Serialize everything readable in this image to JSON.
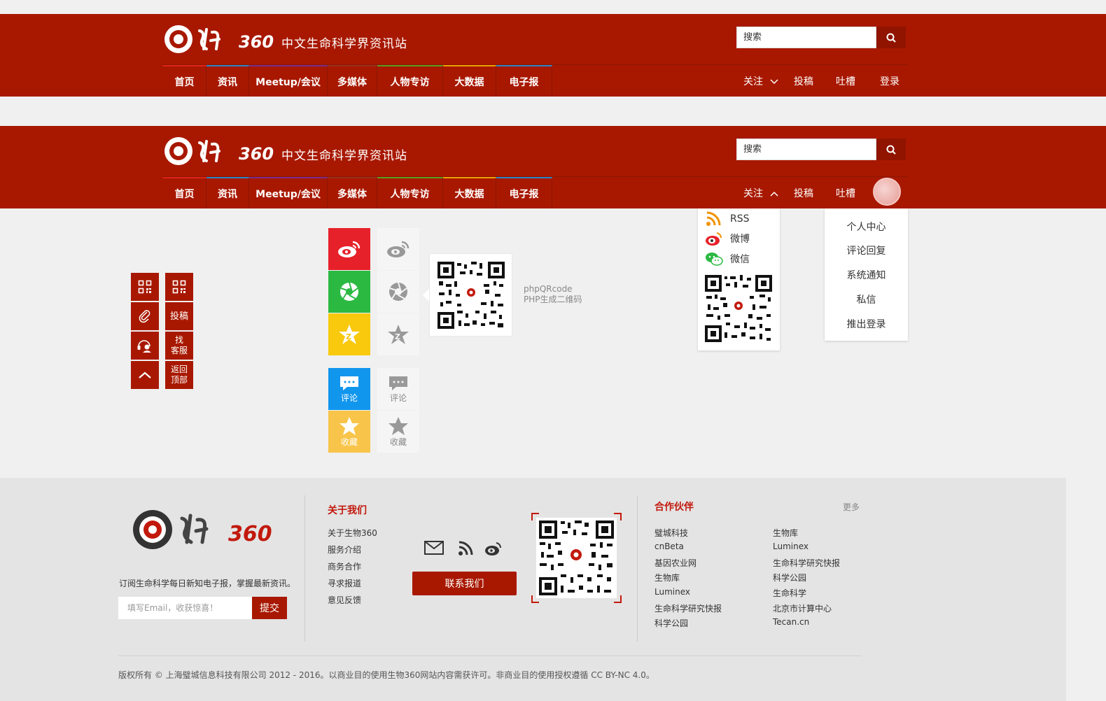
{
  "header": {
    "site_name": "中文生命科学界资讯站",
    "search_placeholder": "搜索",
    "nav": [
      {
        "label": "首页",
        "color": "#e0241a"
      },
      {
        "label": "资讯",
        "color": "#2b86c8"
      },
      {
        "label": "Meetup/会议",
        "color": "#7b2c8c"
      },
      {
        "label": "多媒体",
        "color": "#9a2e1e"
      },
      {
        "label": "人物专访",
        "color": "#5c9c22"
      },
      {
        "label": "大数据",
        "color": "#f0a000"
      },
      {
        "label": "电子报",
        "color": "#2b86c8"
      }
    ],
    "follow": "关注",
    "submit": "投稿",
    "complain": "吐槽",
    "login": "登录"
  },
  "follow_popup": {
    "rss": "RSS",
    "weibo": "微博",
    "wechat": "微信"
  },
  "user_menu": [
    "个人中心",
    "评论回复",
    "系统通知",
    "私信",
    "推出登录"
  ],
  "side_tools": {
    "submit": "投稿",
    "service_1": "找",
    "service_2": "客服",
    "top_1": "返回",
    "top_2": "顶部"
  },
  "share": {
    "comment": "评论",
    "favorite": "收藏",
    "qr_caption_1": "phpQRcode",
    "qr_caption_2": "PHP生成二维码"
  },
  "footer": {
    "subscribe_text": "订阅生命科学每日新知电子报，掌握最新资讯。",
    "email_placeholder": "填写Email，收获惊喜！",
    "submit_label": "提交",
    "about_title": "关于我们",
    "about_links": [
      "关于生物360",
      "服务介绍",
      "商务合作",
      "寻求报道",
      "意见反馈"
    ],
    "contact_label": "联系我们",
    "partners_title": "合作伙伴",
    "more_label": "更多",
    "partners_col1": [
      "璧城科技",
      "cnBeta",
      "基因农业网",
      "生物库",
      "Luminex",
      "生命科学研究快报",
      "科学公园"
    ],
    "partners_col2": [
      "生物库",
      "Luminex",
      "生命科学研究快报",
      "科学公园",
      "生命科学",
      "北京市计算中心",
      "Tecan.cn"
    ],
    "copyright": "版权所有 © 上海璧城信息科技有限公司  2012 - 2016。以商业目的使用生物360网站内容需获许可。非商业目的使用授权遵循 CC BY-NC 4.0。"
  },
  "colors": {
    "brand_red": "#a81800",
    "weibo_red": "#e6212a",
    "wechat_green": "#2bb942",
    "qzone_yellow": "#f8c90c",
    "comment_blue": "#1196ee",
    "favorite_yellow": "#f8c54a"
  }
}
